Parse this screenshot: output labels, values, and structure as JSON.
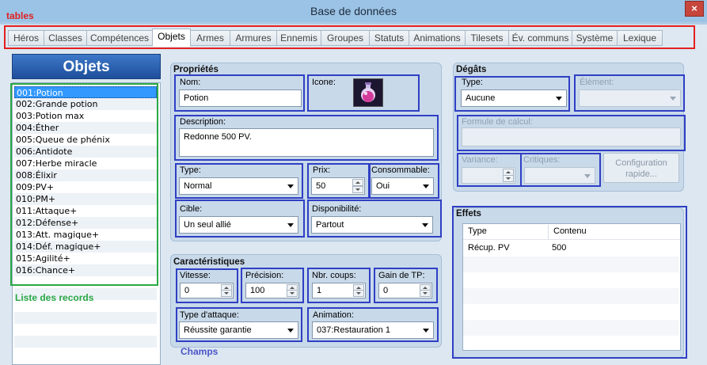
{
  "window": {
    "title": "Base de données",
    "close": "×"
  },
  "annotations": {
    "tables": "tables",
    "records": "Liste des records",
    "fields": "Champs"
  },
  "tabs": [
    "Héros",
    "Classes",
    "Compétences",
    "Objets",
    "Armes",
    "Armures",
    "Ennemis",
    "Groupes",
    "Statuts",
    "Animations",
    "Tilesets",
    "Év. communs",
    "Système",
    "Lexique"
  ],
  "active_tab": "Objets",
  "list": {
    "header": "Objets",
    "items": [
      "001:Potion",
      "002:Grande potion",
      "003:Potion max",
      "004:Éther",
      "005:Queue de phénix",
      "006:Antidote",
      "007:Herbe miracle",
      "008:Élixir",
      "009:PV+",
      "010:PM+",
      "011:Attaque+",
      "012:Défense+",
      "013:Att. magique+",
      "014:Déf. magique+",
      "015:Agilité+",
      "016:Chance+"
    ],
    "selected": 0
  },
  "properties": {
    "title": "Propriétés",
    "name_label": "Nom:",
    "name_value": "Potion",
    "icon_label": "Icone:",
    "icon_name": "potion-icon",
    "desc_label": "Description:",
    "desc_value": "Redonne 500 PV.",
    "type_label": "Type:",
    "type_value": "Normal",
    "price_label": "Prix:",
    "price_value": "50",
    "consumable_label": "Consommable:",
    "consumable_value": "Oui",
    "target_label": "Cible:",
    "target_value": "Un seul allié",
    "availability_label": "Disponibilité:",
    "availability_value": "Partout"
  },
  "characteristics": {
    "title": "Caractéristiques",
    "speed_label": "Vitesse:",
    "speed_value": "0",
    "precision_label": "Précision:",
    "precision_value": "100",
    "hits_label": "Nbr. coups:",
    "hits_value": "1",
    "tp_label": "Gain de TP:",
    "tp_value": "0",
    "attack_type_label": "Type d'attaque:",
    "attack_type_value": "Réussite garantie",
    "animation_label": "Animation:",
    "animation_value": "037:Restauration 1"
  },
  "damage": {
    "title": "Dégâts",
    "type_label": "Type:",
    "type_value": "Aucune",
    "element_label": "Élément:",
    "formula_label": "Formule de calcul:",
    "variance_label": "Variance:",
    "critical_label": "Critiques:",
    "config_button": "Configuration rapide..."
  },
  "effects": {
    "title": "Effets",
    "columns": [
      "Type",
      "Contenu"
    ],
    "rows": [
      [
        "Récup. PV",
        "500"
      ]
    ]
  },
  "colors": {
    "tables_box": "#e41f1f",
    "records_box": "#2aa845",
    "fields_box": "#2f3fc4",
    "selection": "#3399ff"
  }
}
